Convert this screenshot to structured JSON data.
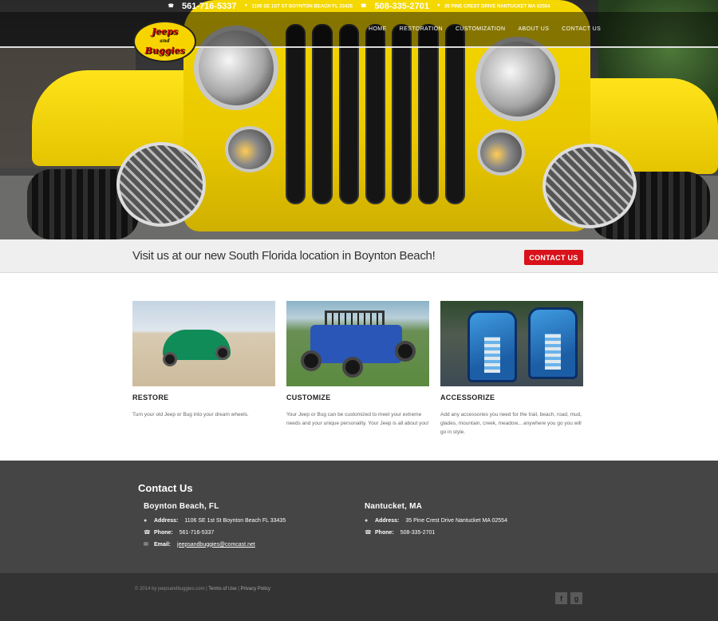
{
  "topbar": {
    "phone1": "561-716-5337",
    "address1": "1106 SE 1ST ST BOYNTON BEACH FL 33435",
    "phone2": "508-335-2701",
    "address2": "35 PINE CREST DRIVE NANTUCKET MA 02554"
  },
  "logo": {
    "line1": "Jeeps",
    "mid": "and",
    "line2": "Buggies"
  },
  "nav": [
    "HOME",
    "RESTORATION",
    "CUSTOMIZATION",
    "ABOUT US",
    "CONTACT US"
  ],
  "banner": {
    "text": "Visit us at our new South Florida location in Boynton Beach!",
    "button": "CONTACT US"
  },
  "features": [
    {
      "title": "RESTORE",
      "text": "Turn your old Jeep or Bug into your dream wheels."
    },
    {
      "title": "CUSTOMIZE",
      "text": "Your Jeep or Bug can be customized to meet your extreme needs and your unique personality. Your Jeep is all about you!"
    },
    {
      "title": "ACCESSORIZE",
      "text": "Add any accessories you need for the trail, beach, road, mud, glades, mountain, creek, meadow... anywhere you go you will go in style."
    }
  ],
  "contact": {
    "title": "Contact Us",
    "fl": {
      "name": "Boynton Beach, FL",
      "address_label": "Address:",
      "address": "1106 SE 1st St Boynton Beach FL 33435",
      "phone_label": "Phone:",
      "phone": "561-716-5337",
      "email_label": "Email:",
      "email": "jeepsandbuggies@comcast.net"
    },
    "ma": {
      "name": "Nantucket, MA",
      "address_label": "Address:",
      "address": "35 Pine Crest Drive Nantucket MA 02554",
      "phone_label": "Phone:",
      "phone": "508-335-2701"
    }
  },
  "footer": {
    "copyright": "© 2014 by jeepsandbuggies.com |",
    "terms": "Terms of Use",
    "sep": "|",
    "privacy": "Privacy Policy",
    "social": [
      "f",
      "g"
    ]
  },
  "colors": {
    "accent_red": "#d8111a",
    "jeep_yellow": "#f5d800",
    "contact_bg": "#454545",
    "footer_bg": "#333333"
  }
}
